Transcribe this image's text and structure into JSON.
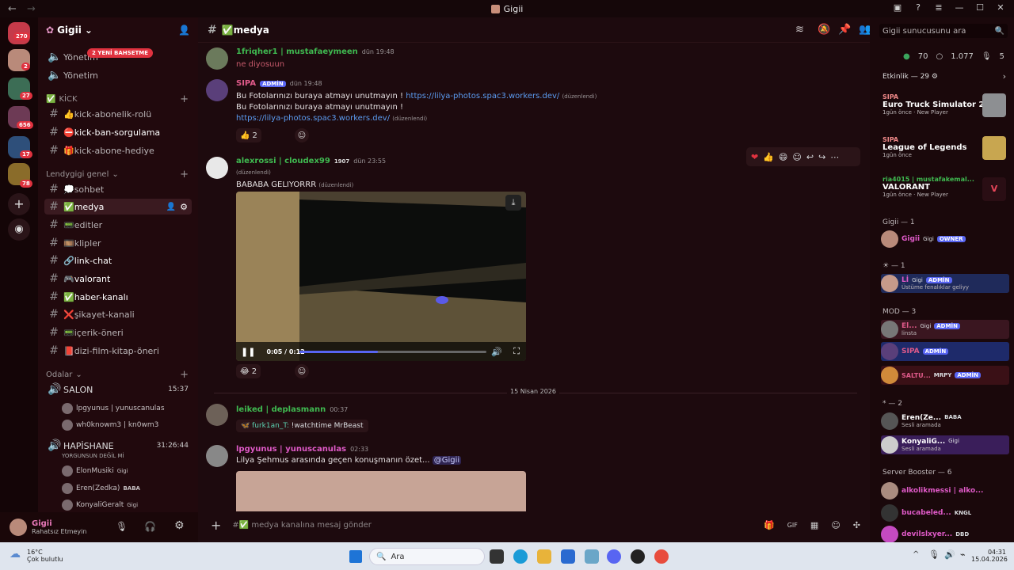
{
  "window": {
    "title": "Gigii"
  },
  "server": {
    "name": "Gigii"
  },
  "guild_badges": [
    "270",
    "2",
    "27",
    "656",
    "17",
    "78"
  ],
  "sidebar": {
    "pinned": [
      {
        "label": "Yönetim",
        "mention_badge": "2 YENİ BAHSETME"
      },
      {
        "label": "Yönetim"
      }
    ],
    "cat_kick": "KİCK",
    "kick_channels": [
      "👍kick-abonelik-rolü",
      "⛔kick-ban-sorgulama",
      "🎁kick-abone-hediye"
    ],
    "cat_genel": "Lendygigi genel",
    "genel_channels": [
      "💭sohbet",
      "✅medya",
      "📟editler",
      "🎞️klipler",
      "🔗link-chat",
      "🎮valorant",
      "✅haber-kanalı",
      "❌şikayet-kanali",
      "📟içerik-öneri",
      "📕dizi-film-kitap-öneri"
    ],
    "cat_rooms": "Odalar",
    "salon": {
      "name": "SALON",
      "time": "15:37"
    },
    "salon_users": [
      "lpgyunus | yunuscanulas",
      "wh0knowm3 | kn0wm3"
    ],
    "hapis": {
      "name": "HAPİSHANE",
      "time": "31:26:44",
      "status": "YORGUNSUN DEĞİL Mİ"
    },
    "hapis_users": [
      {
        "name": "ElonMusiki",
        "tag": "Gigi"
      },
      {
        "name": "Eren(Zedka)",
        "tag": "BABA"
      },
      {
        "name": "KonyaliGeralt",
        "tag": "Gigi"
      }
    ]
  },
  "user_panel": {
    "name": "Gigii",
    "status": "Rahatsız Etmeyin"
  },
  "channel": {
    "name": "✅medya",
    "composer_placeholder": "#✅ medya kanalına mesaj gönder"
  },
  "messages": {
    "m1": {
      "author": "1friqher1 | mustafaeymeen",
      "time": "dün 19:48",
      "text": "ne diyosuun"
    },
    "m2": {
      "author": "SIPA",
      "badge": "ADMİN",
      "time": "dün 19:48",
      "line1": "Bu Fotolarınızı buraya atmayı unutmayın !",
      "link": "https://lilya-photos.spac3.workers.dev/",
      "edited": "(düzenlendi)",
      "line2": "Bu Fotolarınızı buraya atmayı unutmayın !",
      "reaction_count": "2"
    },
    "m3": {
      "author": "alexrossi | cloudex99",
      "clan": "1907",
      "time": "dün 23:55",
      "edited": "(düzenlendi)",
      "text": "BABABA GELIYORRR",
      "video_time": "0:05 / 0:12",
      "video_progress": 0.42,
      "reaction_count": "2"
    },
    "divider": "15 Nisan 2026",
    "m4": {
      "author": "leiked | deplasmann",
      "time": "00:37",
      "embed_user": "furk1an_T:",
      "embed_text": "!watchtime MrBeast"
    },
    "m5": {
      "author": "lpgyunus | yunuscanulas",
      "time": "02:33",
      "text": "Lilya Şehmus arasında geçen konuşmanın özet...",
      "mention": "@Gigii"
    }
  },
  "members_panel": {
    "search_placeholder": "Gigii sunucusunu ara",
    "stats": {
      "online": "70",
      "total": "1.077",
      "voice": "5"
    },
    "activity_title": "Etkinlik — 29",
    "activities": [
      {
        "user": "SIPA",
        "game": "Euro Truck Simulator 2",
        "sub": "1gün önce",
        "extra": "New Player"
      },
      {
        "user": "SIPA",
        "game": "League of Legends",
        "sub": "1gün önce",
        "extra": ""
      },
      {
        "user": "ria4015 | mustafakemal...",
        "game": "VALORANT",
        "sub": "1gün önce",
        "extra": "New Player"
      }
    ],
    "groups": {
      "gigii": "Gigii — 1",
      "sun": "— 1",
      "mod": "MOD — 3",
      "star": "* — 2",
      "booster": "Server Booster — 6"
    },
    "members": {
      "gigii": {
        "name": "Gigii",
        "tag": "Gigi",
        "role": "OWNER"
      },
      "li": {
        "name": "Lİ",
        "tag": "Gigi",
        "role": "ADMİN",
        "status": "Üstüme fenalıklar geliyy"
      },
      "el": {
        "name": "El...",
        "tag": "Gigi",
        "role": "ADMİN",
        "status": "linsta"
      },
      "sipa": {
        "name": "SIPA",
        "role": "ADMİN"
      },
      "saltu": {
        "name": "SALTU...",
        "tag": "MRPY",
        "role": "ADMİN"
      },
      "eren": {
        "name": "Eren(Ze...",
        "tag": "BABA",
        "status": "Sesli aramada"
      },
      "konya": {
        "name": "KonyaliG...",
        "tag": "Gigi",
        "status": "Sesli aramada"
      },
      "alko": {
        "name": "alkolikmessi | alko..."
      },
      "buca": {
        "name": "bucabeled...",
        "tag": "KNGL"
      },
      "devil": {
        "name": "devilslxyer...",
        "tag": "DBD"
      }
    }
  },
  "taskbar": {
    "weather_temp": "16°C",
    "weather_text": "Çok bulutlu",
    "search": "Ara",
    "time": "04:31",
    "date": "15.04.2026"
  }
}
